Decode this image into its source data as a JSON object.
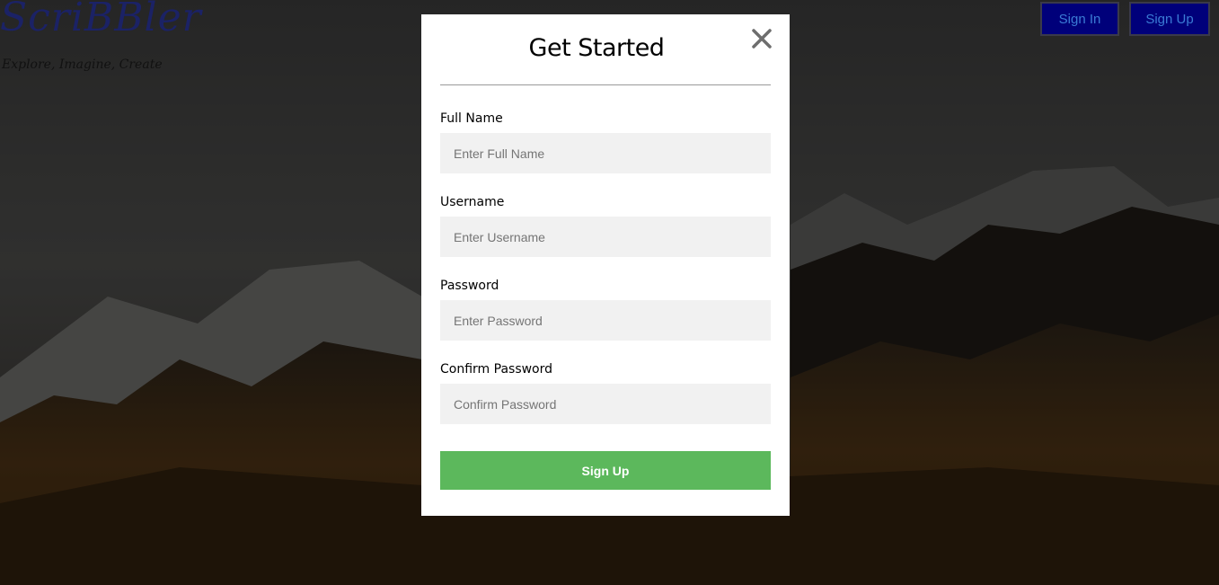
{
  "brand": {
    "logo_text": "ScriBBler",
    "tagline": "Explore, Imagine, Create"
  },
  "nav": {
    "sign_in_label": "Sign In",
    "sign_up_label": "Sign Up"
  },
  "modal": {
    "title": "Get Started",
    "close_icon": "close-icon",
    "fields": [
      {
        "label": "Full Name",
        "placeholder": "Enter Full Name",
        "value": ""
      },
      {
        "label": "Username",
        "placeholder": "Enter Username",
        "value": ""
      },
      {
        "label": "Password",
        "placeholder": "Enter Password",
        "value": ""
      },
      {
        "label": "Confirm Password",
        "placeholder": "Confirm Password",
        "value": ""
      }
    ],
    "submit_label": "Sign Up"
  },
  "colors": {
    "nav_button_bg": "#00007a",
    "nav_button_text": "#3a7bd5",
    "submit_bg": "#5cb85c",
    "input_bg": "#f1f1f1",
    "logo": "#1b2266"
  }
}
